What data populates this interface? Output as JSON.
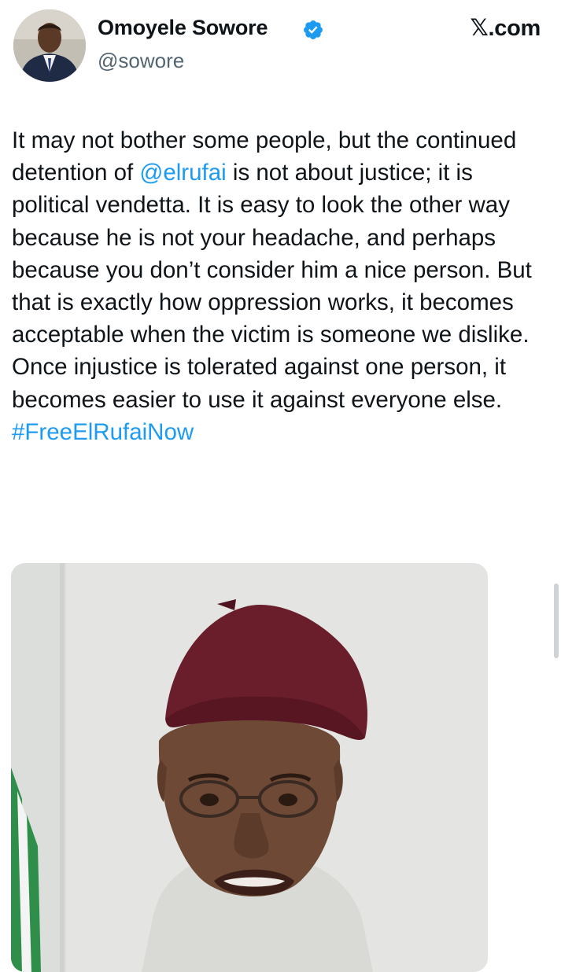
{
  "author": {
    "name": "Omoyele Sowore",
    "handle": "@sowore",
    "verified_color": "#1d9bf0"
  },
  "site_label": "𝕏.com",
  "tweet": {
    "text_before_mention": "It may not bother some people, but the continued detention of ",
    "mention": "@elrufai",
    "text_after_mention": " is not about justice; it is political vendetta. It is easy to look the other way because he is not your headache, and perhaps because you don’t consider him a nice person. But that is exactly how oppression works, it becomes acceptable when the victim is someone we dislike. Once injustice is tolerated against one person, it becomes easier to use it against everyone else. ",
    "hashtag": "#FreeElRufaiNow"
  },
  "colors": {
    "link": "#1d9bf0",
    "text": "#0f1419",
    "secondary_text": "#536471"
  }
}
